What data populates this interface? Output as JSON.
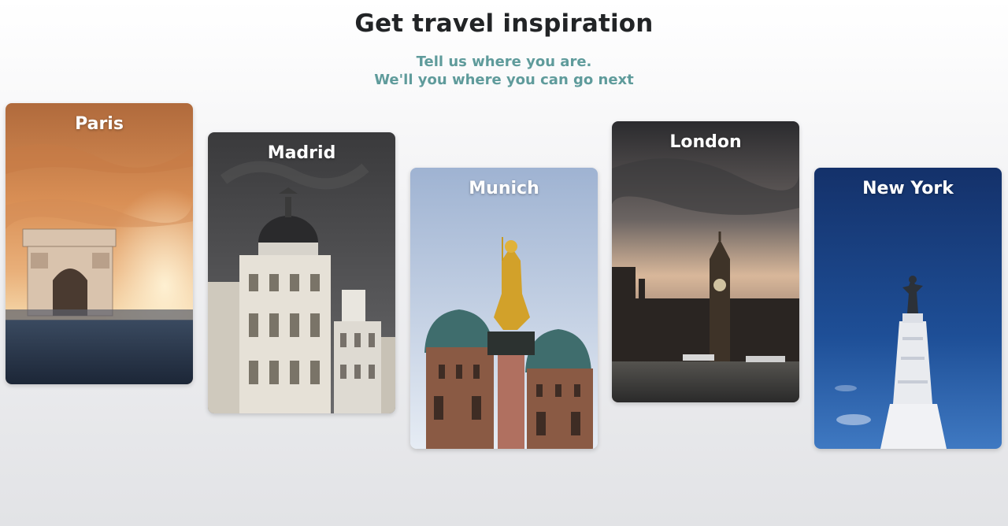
{
  "header": {
    "title": "Get travel inspiration",
    "subtitle_line1": "Tell us where you are.",
    "subtitle_line2": "We'll you where you can go next"
  },
  "colors": {
    "title": "#222426",
    "subtitle": "#5f9b9b"
  },
  "cards": [
    {
      "city": "Paris",
      "image": "arc-de-triomphe-sunset"
    },
    {
      "city": "Madrid",
      "image": "metropolis-building"
    },
    {
      "city": "Munich",
      "image": "mariensaule-frauenkirche"
    },
    {
      "city": "London",
      "image": "big-ben-thames"
    },
    {
      "city": "New York",
      "image": "statue-monument-blue-sky"
    }
  ]
}
